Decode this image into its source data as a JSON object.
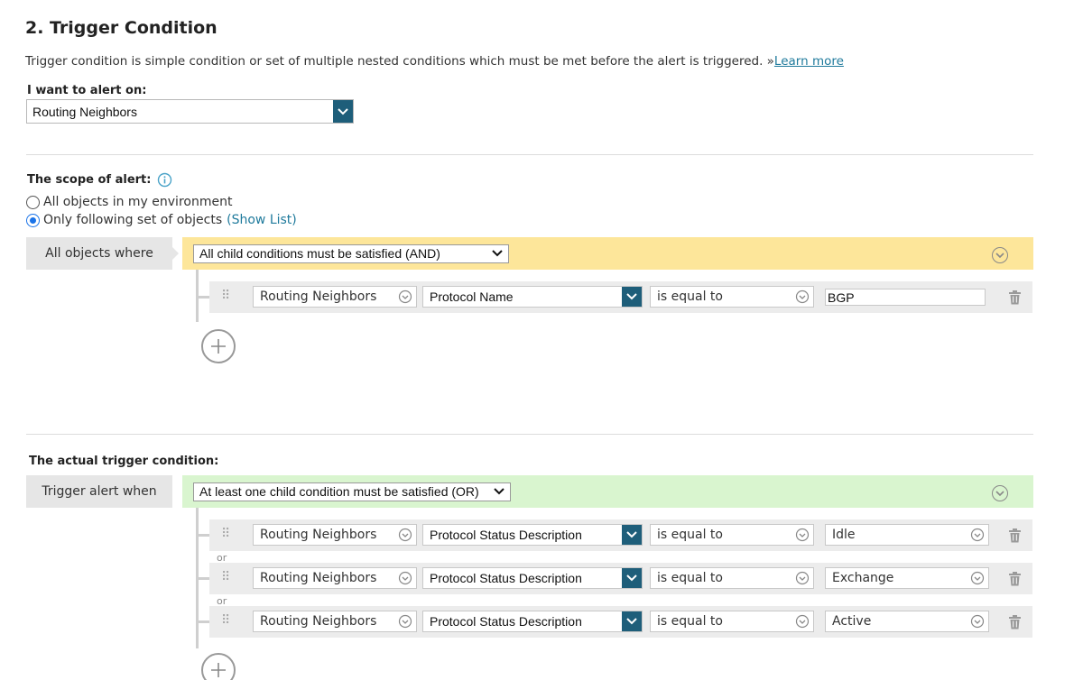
{
  "section": {
    "title": "2. Trigger Condition",
    "description": "Trigger condition is simple condition or set of multiple nested conditions which must be met before the alert is triggered. »",
    "learn_more": "Learn more"
  },
  "alert_on": {
    "label": "I want to alert on:",
    "value": "Routing Neighbors"
  },
  "scope": {
    "label": "The scope of alert:",
    "option_all": "All objects in my environment",
    "option_following": "Only following set of objects",
    "show_list": "(Show List)",
    "selected": "Only following set of objects",
    "left_tab": "All objects where",
    "group_operator": "All child conditions must be satisfied (AND)",
    "conditions": [
      {
        "object": "Routing Neighbors",
        "property": "Protocol Name",
        "operator": "is equal to",
        "value": "BGP"
      }
    ]
  },
  "trigger": {
    "label": "The actual trigger condition:",
    "left_tab": "Trigger alert when",
    "group_operator": "At least one child condition must be satisfied (OR)",
    "joiner": "or",
    "conditions": [
      {
        "object": "Routing Neighbors",
        "property": "Protocol Status Description",
        "operator": "is equal to",
        "value": "Idle"
      },
      {
        "object": "Routing Neighbors",
        "property": "Protocol Status Description",
        "operator": "is equal to",
        "value": "Exchange"
      },
      {
        "object": "Routing Neighbors",
        "property": "Protocol Status Description",
        "operator": "is equal to",
        "value": "Active"
      }
    ]
  },
  "colors": {
    "and_bar": "#fde69a",
    "or_bar": "#d9f5cf",
    "accent_blue": "#1e5e7a",
    "link": "#1f7a9c"
  },
  "icons": {
    "info": "info-icon",
    "drag": "drag-handle-icon",
    "delete": "trash-icon",
    "add": "plus-icon",
    "dropdown": "chevron-down-icon"
  }
}
